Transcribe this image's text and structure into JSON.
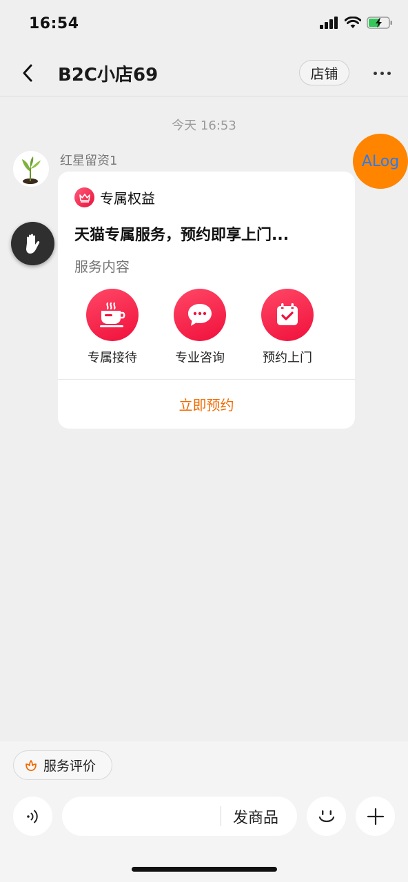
{
  "status_bar": {
    "time": "16:54"
  },
  "header": {
    "title": "B2C小店69",
    "store_label": "店铺"
  },
  "chat": {
    "timestamp": "今天 16:53",
    "sender_name": "红星留资1",
    "alog_label": "ALog"
  },
  "card": {
    "badge_label": "专属权益",
    "title": "天猫专属服务，预约即享上门...",
    "subtitle": "服务内容",
    "services": [
      {
        "label": "专属接待",
        "icon": "coffee-cup-icon"
      },
      {
        "label": "专业咨询",
        "icon": "chat-bubble-icon"
      },
      {
        "label": "预约上门",
        "icon": "calendar-check-icon"
      }
    ],
    "action_label": "立即预约"
  },
  "bottom": {
    "review_label": "服务评价",
    "send_product_label": "发商品"
  },
  "colors": {
    "accent_red": "#f0103c",
    "action_orange": "#f06a00",
    "alog_orange": "#ff8400"
  }
}
